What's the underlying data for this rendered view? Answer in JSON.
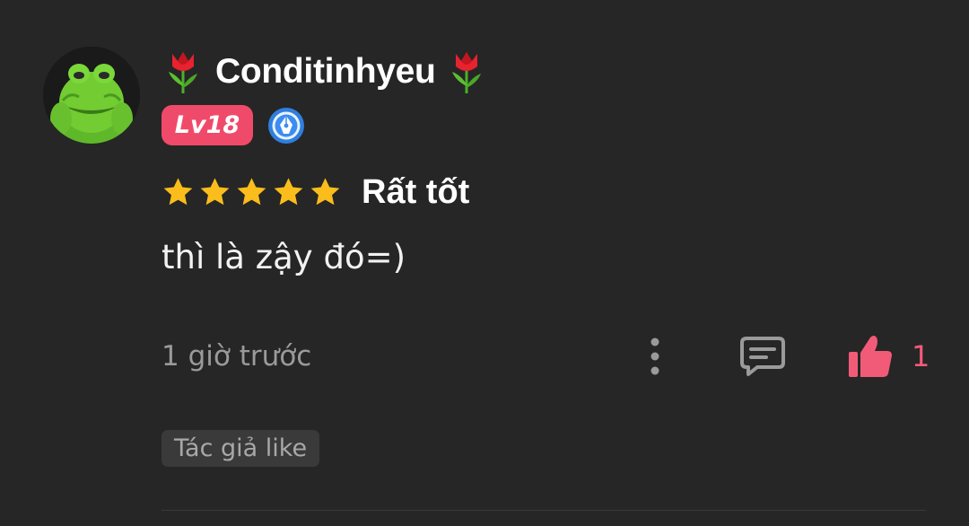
{
  "user": {
    "name": "Conditinhyeu",
    "level_badge": "Lv18",
    "avatar_icon": "green-frog-avatar",
    "decoration_icon": "tulip-emoji",
    "author_icon": "pen-nib-badge-icon"
  },
  "review": {
    "rating": 5,
    "rating_max": 5,
    "rating_text": "Rất tốt",
    "comment": "thì là zậy đó=)"
  },
  "meta": {
    "timestamp": "1 giờ trước",
    "like_count": "1",
    "author_like_tag": "Tác giả like"
  },
  "icons": {
    "more": "vertical-dots-icon",
    "reply": "comment-icon",
    "like": "thumbs-up-icon"
  },
  "colors": {
    "background": "#262626",
    "accent": "#f04a6a",
    "star": "#fbbd1c",
    "muted": "#9a9a9a"
  }
}
